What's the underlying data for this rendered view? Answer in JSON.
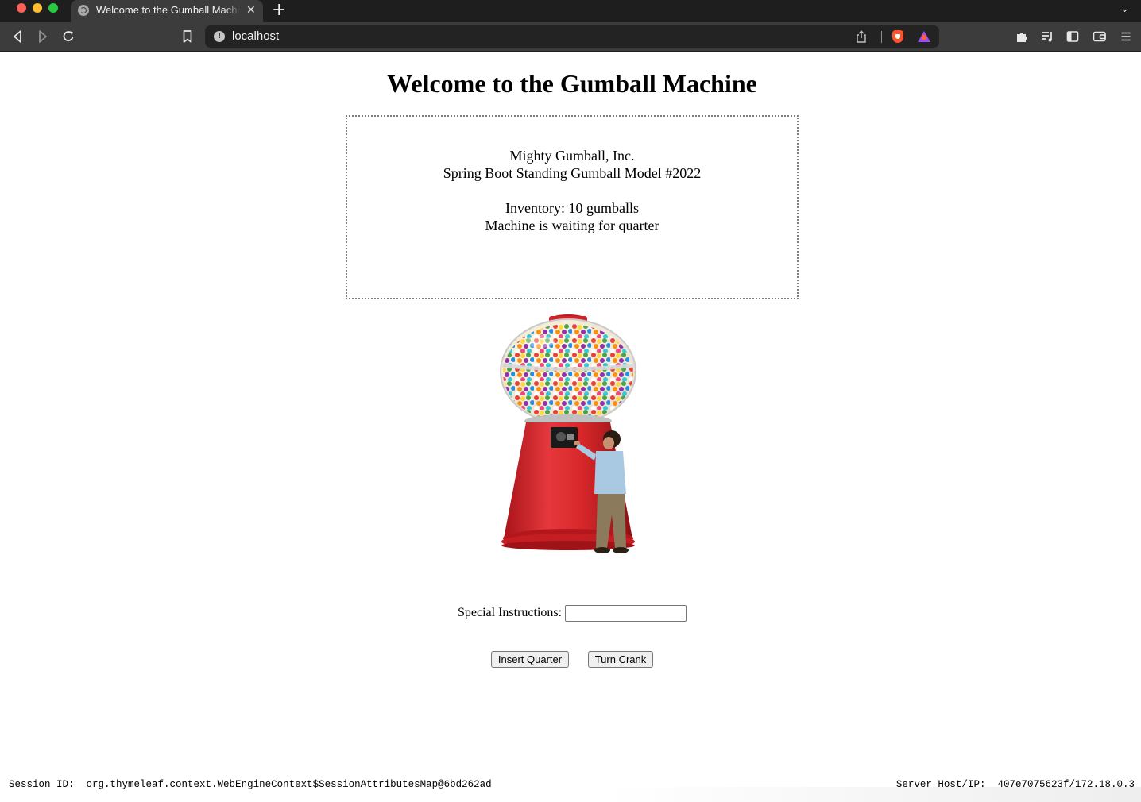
{
  "browser": {
    "tab_title": "Welcome to the Gumball Machine",
    "url": "localhost",
    "colors": {
      "chrome_dark": "#1e1e1f",
      "toolbar": "#3c3c3d",
      "urlbar": "#232324",
      "brave_orange": "#fb542b"
    },
    "icons": [
      "back-icon",
      "forward-icon",
      "reload-icon",
      "bookmark-icon",
      "info-icon",
      "share-icon",
      "brave-shields-icon",
      "brave-rewards-icon",
      "extensions-icon",
      "playlist-icon",
      "sidebar-icon",
      "wallet-icon",
      "menu-icon"
    ]
  },
  "page": {
    "title": "Welcome to the Gumball Machine",
    "status_lines": [
      "Mighty Gumball, Inc.",
      "Spring Boot Standing Gumball Model #2022",
      "",
      "Inventory: 10 gumballs",
      "Machine is waiting for quarter"
    ],
    "instructions_label": "Special Instructions:",
    "instructions_value": "",
    "insert_button": "Insert Quarter",
    "crank_button": "Turn Crank"
  },
  "footer": {
    "session_label": "Session ID:",
    "session_value": "org.thymeleaf.context.WebEngineContext$SessionAttributesMap@6bd262ad",
    "server_label": "Server Host/IP:",
    "server_value": "407e7075623f/172.18.0.3"
  },
  "colors": {
    "machine_red": "#d9282b",
    "page_bg": "#ffffff"
  }
}
